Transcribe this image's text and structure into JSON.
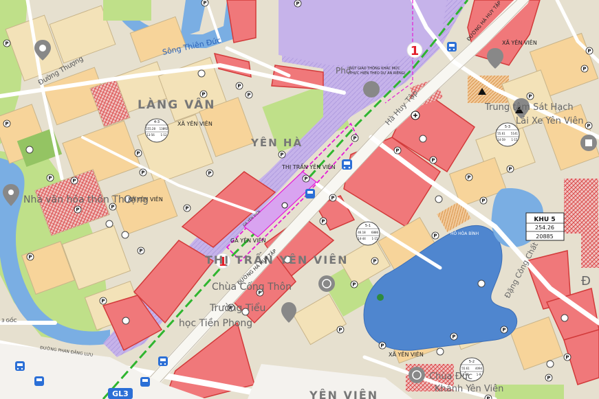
{
  "map": {
    "labels": {
      "song_thien_duc": "Sông Thiên Đức",
      "duong_thuong": "Đường Thượng",
      "lang_van": "LÀNG VÂN",
      "yen_ha": "YÊN HÀ",
      "thi_tran_yen_vien_big": "THỊ TRẤN YÊN VIÊN",
      "yen_vien_bottom": "YÊN VIÊN",
      "xa_yen_vien_1": "XÃ YÊN VIÊN",
      "xa_yen_vien_2": "XÃ YÊN VIÊN",
      "xa_yen_vien_3": "XÃ YÊN VIÊN",
      "xa_yen_vien_4": "XÃ YÊN VIÊN",
      "thi_tran_yen_vien": "THỊ TRẤN YÊN VIÊN",
      "ga_yen_vien": "GA YÊN VIÊN",
      "ga_yen_vien_small": "GA YÊN VIÊN",
      "duong_ha_huy_tap_1": "ĐƯỜNG HÀ HUY TẬP",
      "duong_ha_huy_tap_2": "ĐƯỜNG HÀ HUY TẬP",
      "ha_huy_tap_road": "Hà Huy Tập",
      "duong_phan_dang_luu": "ĐƯỜNG PHAN ĐĂNG LƯU",
      "dang_cong_chat": "Đặng Công Chất",
      "ho_hoa_binh": "HỒ HÒA BÌNH",
      "nut_giao_1": "NÚT GIAO THÔNG KHÁC MỨC",
      "nut_giao_2": "(THỰC HIỆN THEO DỰ ÁN RIÊNG)",
      "nha_van_hoa": "Nhà văn hóa thôn Thượng",
      "chua_cong_thon": "Chùa Cống Thôn",
      "truong_tieu_hoc": "Trường Tiểu",
      "truong_tieu_hoc_2": "học Tiền Phong",
      "trung_tam": "Trung tâm Sát Hạch",
      "trung_tam_2": "Lái Xe Yên Viên",
      "chua_khanh": "Chùa Đức",
      "chua_khanh_2": "Khánh Yên Viên",
      "ba_goc": "3 GỐC",
      "pho_ben": "Phố",
      "route_number_1": "1",
      "route_number_2": "1",
      "bus_code": "GL3",
      "big_d": "Đ"
    },
    "khu5": {
      "title": "KHU 5",
      "area": "254.26",
      "population": "20885"
    },
    "lot_codes": {
      "lot_43": {
        "code": "4-3",
        "a": "155.28",
        "b": "13892",
        "c": "13-56",
        "d": "1-12"
      },
      "lot_51": {
        "code": "5-1",
        "a": "46.18",
        "b": "6886",
        "c": "14-44",
        "d": "1-15"
      },
      "lot_52": {
        "code": "5-2",
        "a": "55.61",
        "b": "4094",
        "c": "8-60",
        "d": "1-9"
      },
      "lot_53": {
        "code": "5-3",
        "a": "55.61",
        "b": "5141",
        "c": "14-59",
        "d": "1-15"
      }
    },
    "colors": {
      "residential": "#f7d49a",
      "residential_light": "#f3e2b8",
      "commercial": "#f0787a",
      "commercial_border": "#d23a3a",
      "rail_zone": "#c6b3ea",
      "water": "#7aaee3",
      "water_dark": "#4f86cf",
      "green": "#bfe089",
      "green_dark": "#94c463",
      "road": "#ffffff",
      "road_edge": "#b8b0a0",
      "rail_line": "#2fb52f",
      "magenta": "#e41bd6",
      "pattern_red": "#d94444",
      "mixed": "#eecfd0",
      "bus_blue": "#2b6fd6"
    },
    "icons": {
      "parking": "parking-icon",
      "bus": "bus-icon",
      "pin": "map-pin-icon",
      "temple": "temple-icon",
      "school": "school-icon"
    }
  }
}
